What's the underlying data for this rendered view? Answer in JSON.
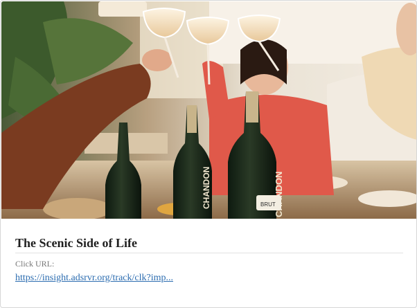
{
  "card": {
    "image_alt": "Friends toasting with champagne coupes around a dinner table with Chandon bottles",
    "title": "The Scenic Side of Life",
    "url_label": "Click URL:",
    "url_text": "https://insight.adsrvr.org/track/clk?imp...",
    "bottle_brand": "CHANDON",
    "bottle_label": "BRUT"
  },
  "colors": {
    "link": "#2b6cb0",
    "title": "#1f1f1f",
    "sweater_red": "#e0594a",
    "sweater_brown": "#7a3b20"
  }
}
